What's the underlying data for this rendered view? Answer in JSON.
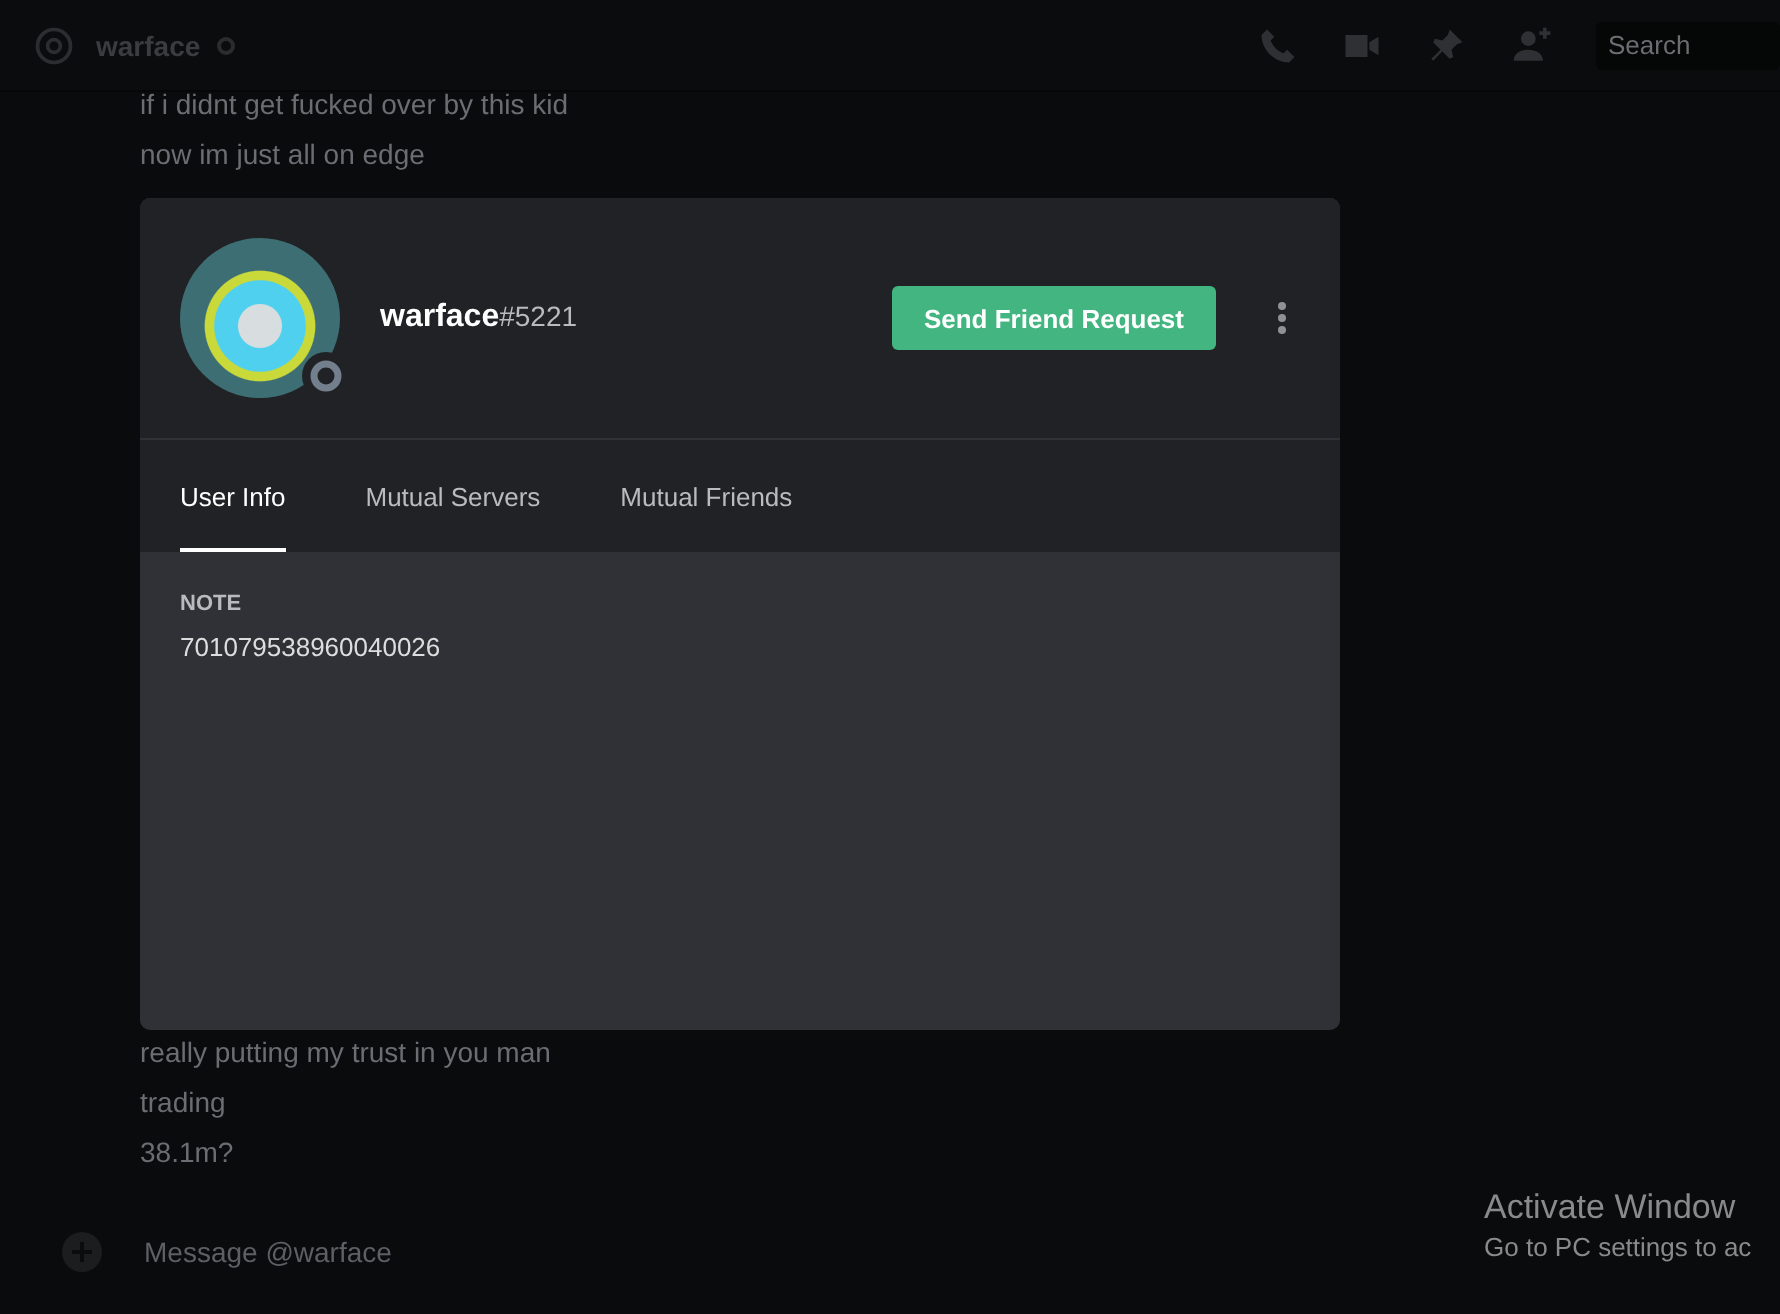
{
  "header": {
    "channel_name": "warface",
    "search": {
      "placeholder": "Search"
    }
  },
  "messages_top": [
    "if i didnt get fucked over by this kid",
    "now im just all on edge"
  ],
  "messages_bottom": [
    "really putting my trust in you man",
    "trading",
    "38.1m?"
  ],
  "composer": {
    "placeholder": "Message @warface"
  },
  "profile": {
    "username": "warface",
    "discriminator": "#5221",
    "action_button": "Send Friend Request",
    "tabs": [
      {
        "label": "User Info",
        "selected": true
      },
      {
        "label": "Mutual Servers",
        "selected": false
      },
      {
        "label": "Mutual Friends",
        "selected": false
      }
    ],
    "note_label": "NOTE",
    "note_value": "701079538960040026"
  },
  "os_notice": {
    "title": "Activate Window",
    "subtitle": "Go to PC settings to ac"
  }
}
